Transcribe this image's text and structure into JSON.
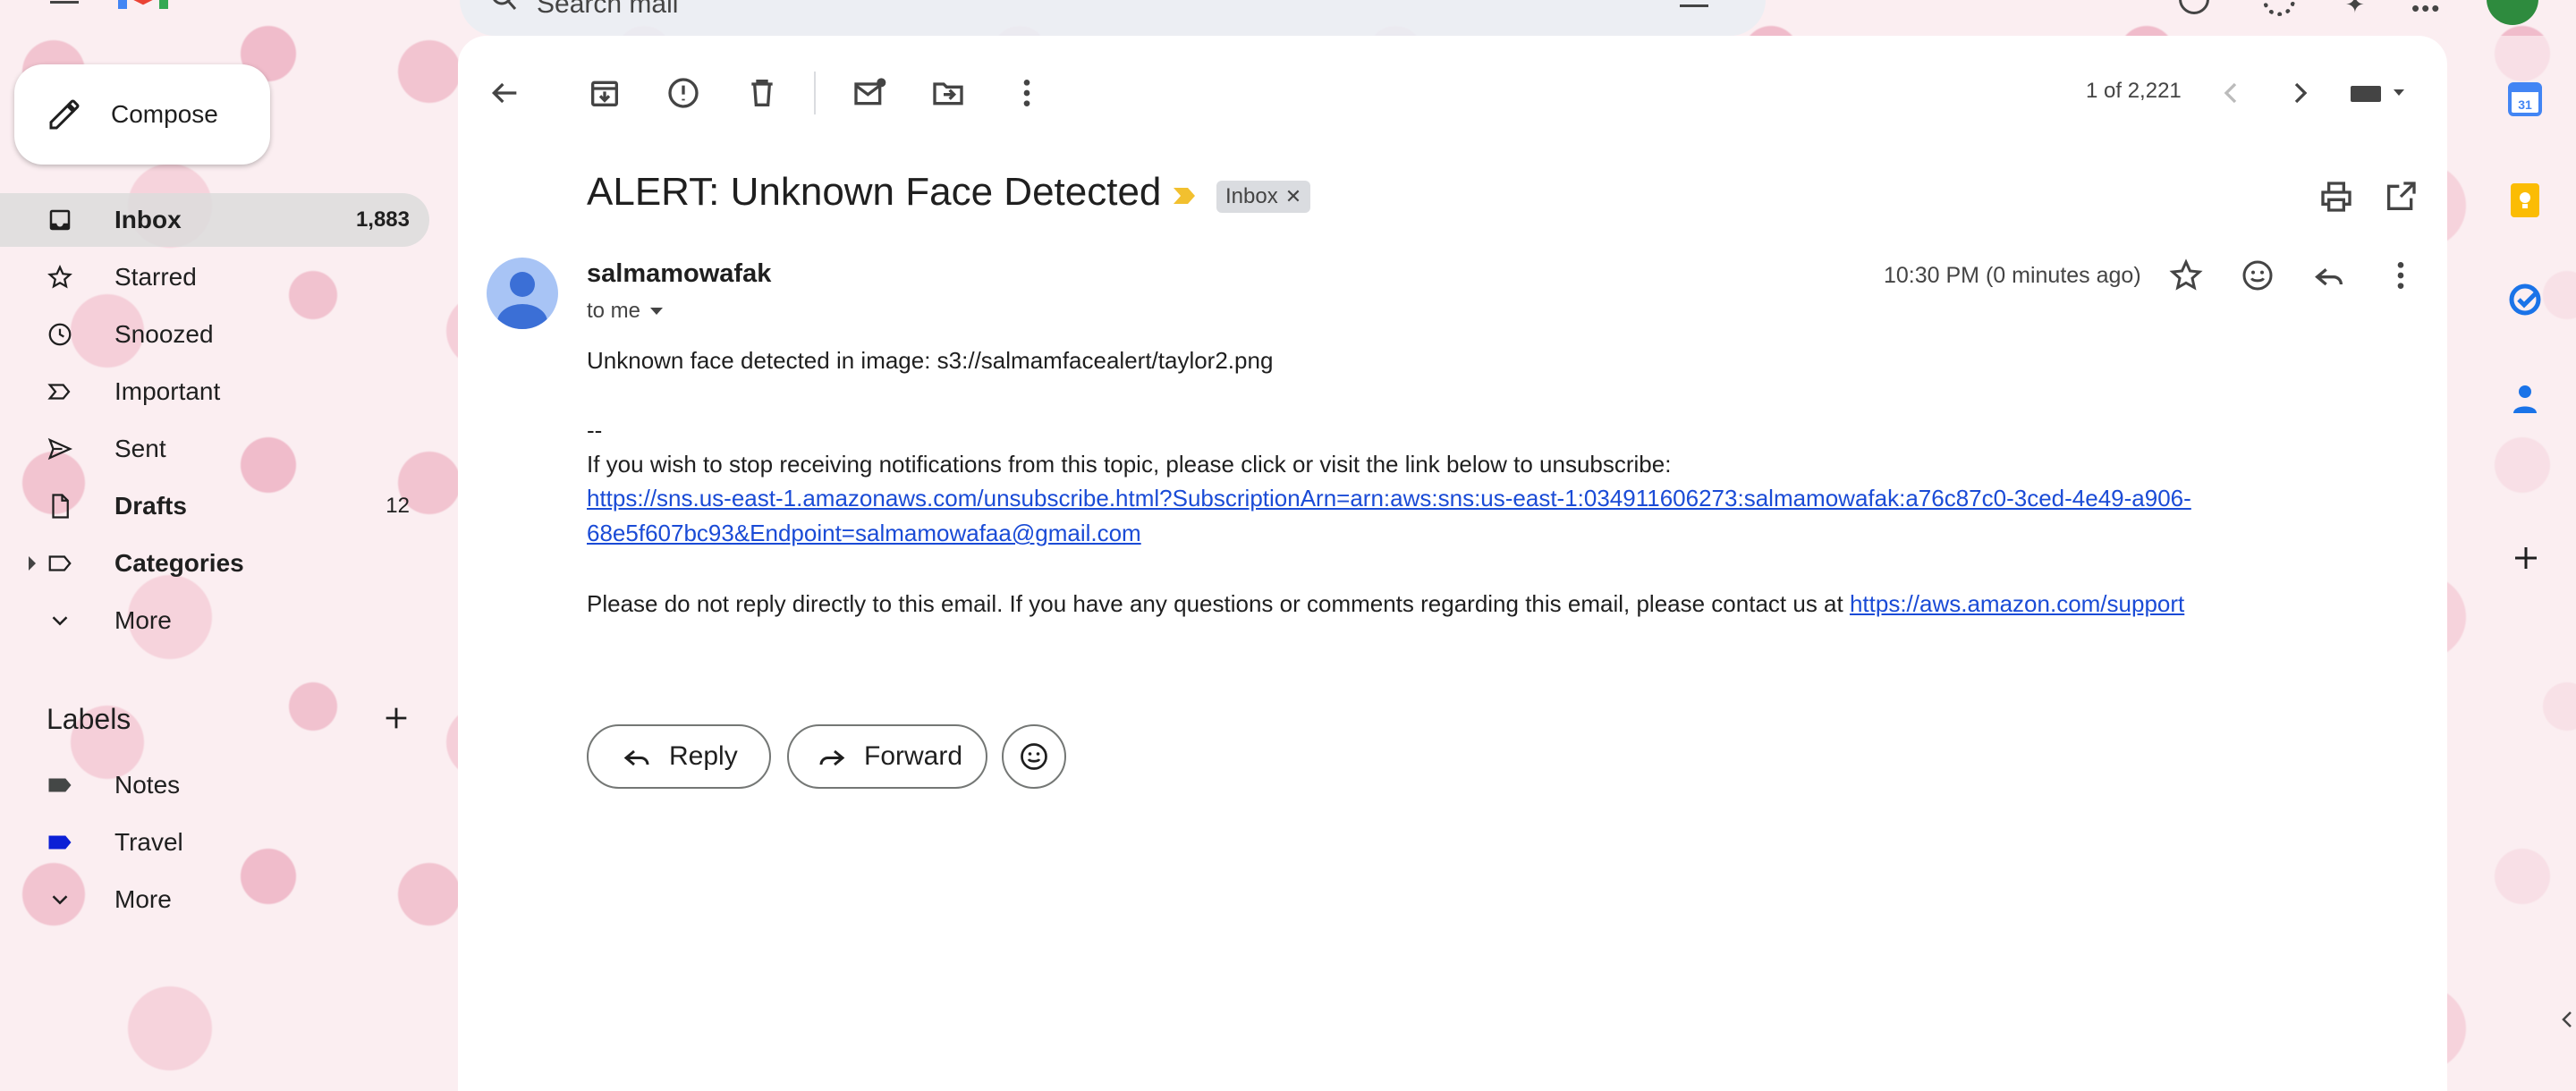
{
  "header": {
    "app_name": "Gmail",
    "search_placeholder": "Search mail"
  },
  "sidebar": {
    "compose_label": "Compose",
    "items": [
      {
        "label": "Inbox",
        "count": "1,883",
        "icon": "inbox-icon",
        "active": true,
        "bold": true
      },
      {
        "label": "Starred",
        "count": "",
        "icon": "star-icon"
      },
      {
        "label": "Snoozed",
        "count": "",
        "icon": "clock-icon"
      },
      {
        "label": "Important",
        "count": "",
        "icon": "important-icon"
      },
      {
        "label": "Sent",
        "count": "",
        "icon": "send-icon"
      },
      {
        "label": "Drafts",
        "count": "12",
        "icon": "draft-icon",
        "bold": true
      },
      {
        "label": "Categories",
        "count": "",
        "icon": "label-icon",
        "bold": true
      },
      {
        "label": "More",
        "count": "",
        "icon": "chevron-down-icon"
      }
    ],
    "labels_title": "Labels",
    "labels": [
      {
        "label": "Notes",
        "color": "#444746"
      },
      {
        "label": "Travel",
        "color": "#0b1fd6"
      },
      {
        "label": "More",
        "icon": "chevron-down-icon"
      }
    ]
  },
  "toolbar": {
    "pagination": "1 of 2,221"
  },
  "message": {
    "subject": "ALERT: Unknown Face Detected",
    "chip_label": "Inbox",
    "sender": "salmamowafak",
    "to_me": "to me",
    "timestamp": "10:30 PM (0 minutes ago)",
    "line1": "Unknown face detected in image: s3://salmamfacealert/taylor2.png",
    "separator": "--",
    "unsubscribe_text": "If you wish to stop receiving notifications from this topic, please click or visit the link below to unsubscribe:",
    "unsubscribe_link_1": "https://sns.us-east-1.amazonaws.com/unsubscribe.html?SubscriptionArn=arn:aws:sns:us-east-1:034911606273:salmamowafak:a76c87c0-3ced-4e49-a906-",
    "unsubscribe_link_2": "68e5f607bc93&Endpoint=salmamowafaa@gmail.com",
    "footer_text": "Please do not reply directly to this email. If you have any questions or comments regarding this email, please contact us at",
    "footer_link": "https://aws.amazon.com/support"
  },
  "actions": {
    "reply_label": "Reply",
    "forward_label": "Forward"
  },
  "colors": {
    "important_marker": "#f2c02f",
    "link": "#1a4bd6",
    "calendar": "#4285f4",
    "keep": "#fbbc04",
    "tasks": "#1a73e8"
  }
}
